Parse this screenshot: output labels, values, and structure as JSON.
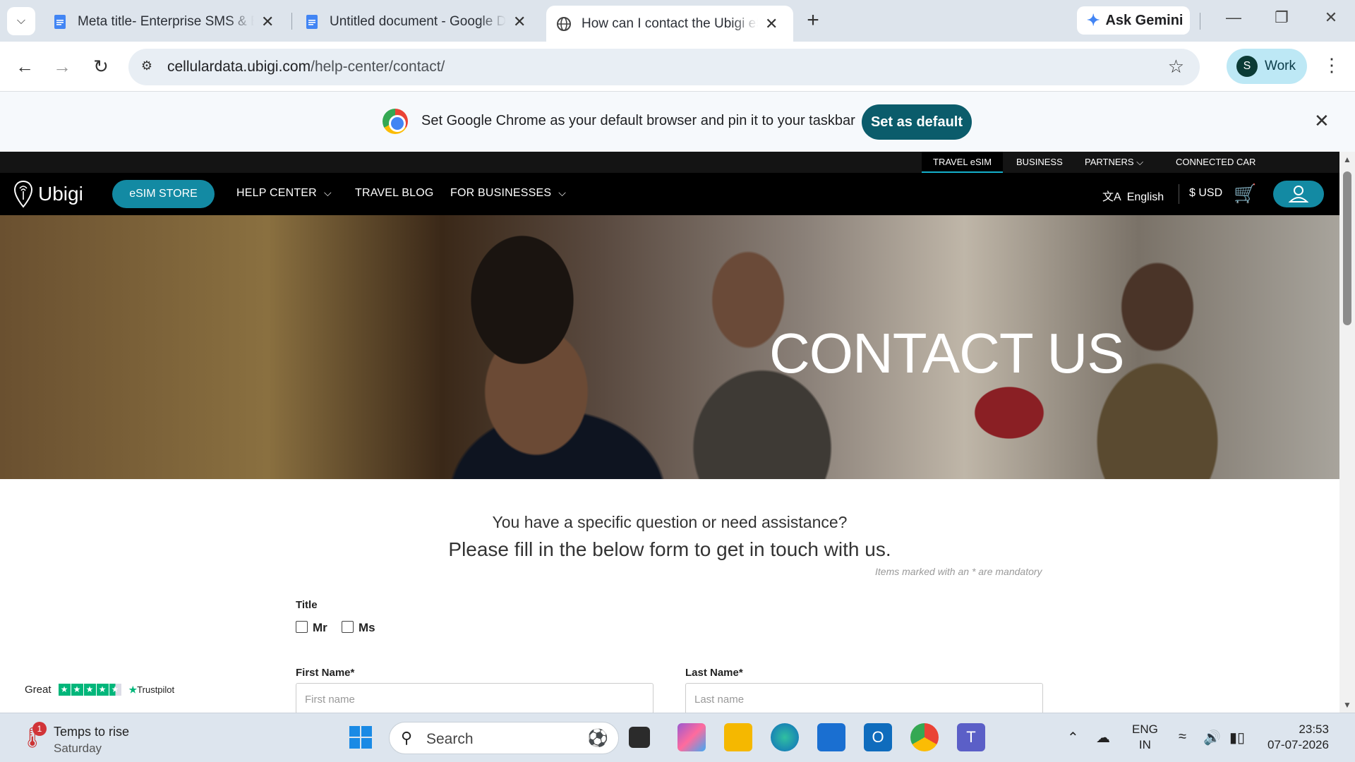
{
  "browser": {
    "tabs": [
      {
        "title": "Meta title- Enterprise SMS & Bu",
        "icon": "google-docs-icon"
      },
      {
        "title": "Untitled document - Google Do",
        "icon": "google-docs-icon"
      },
      {
        "title": "How can I contact the Ubigi eSI",
        "icon": "globe-icon",
        "active": true
      }
    ],
    "ask_gemini": "Ask Gemini",
    "url_domain": "cellulardata.ubigi.com",
    "url_path": "/help-center/contact/",
    "profile_initial": "S",
    "profile_label": "Work"
  },
  "banner": {
    "message": "Set Google Chrome as your default browser and pin it to your taskbar",
    "button": "Set as default"
  },
  "site": {
    "topbar": [
      "TRAVEL eSIM",
      "BUSINESS",
      "PARTNERS",
      "CONNECTED CAR"
    ],
    "logo": "Ubigi",
    "esim_store": "eSIM STORE",
    "nav": [
      "HELP CENTER",
      "TRAVEL BLOG",
      "FOR BUSINESSES"
    ],
    "language": "English",
    "currency": "$ USD",
    "hero_title": "CONTACT US",
    "question": "You have a specific question or need assistance?",
    "instruction": "Please fill in the below form to get in touch with us.",
    "mandatory_note": "Items marked with an * are mandatory",
    "form": {
      "title_label": "Title",
      "opt_mr": "Mr",
      "opt_ms": "Ms",
      "first_name_label": "First Name*",
      "first_name_placeholder": "First name",
      "last_name_label": "Last Name*",
      "last_name_placeholder": "Last name"
    },
    "trustpilot": {
      "rating_word": "Great",
      "brand": "Trustpilot",
      "stars": 4.5
    }
  },
  "taskbar": {
    "weather_title": "Temps to rise",
    "weather_sub": "Saturday",
    "weather_badge": "1",
    "search": "Search",
    "lang_1": "ENG",
    "lang_2": "IN",
    "time": "23:53",
    "date": "07-07-2026"
  }
}
